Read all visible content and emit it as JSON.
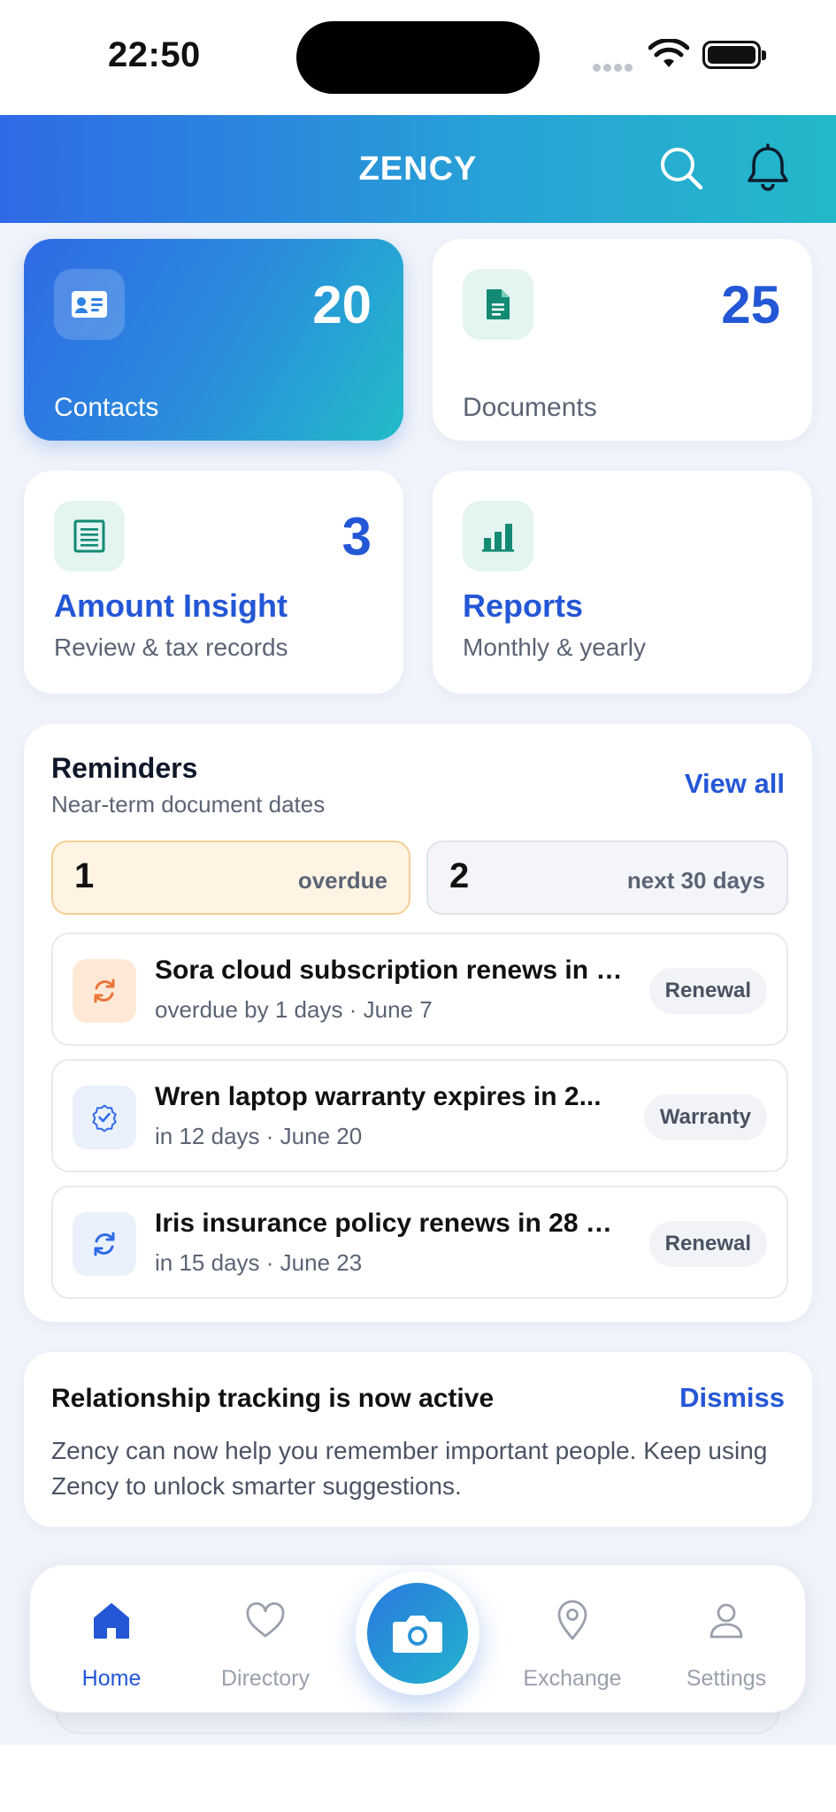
{
  "status_bar": {
    "time": "22:50"
  },
  "header": {
    "title": "ZENCY"
  },
  "stats": {
    "contacts": {
      "count": "20",
      "label": "Contacts"
    },
    "documents": {
      "count": "25",
      "label": "Documents"
    }
  },
  "features": {
    "amount_insight": {
      "count": "3",
      "title": "Amount Insight",
      "subtitle": "Review & tax records"
    },
    "reports": {
      "title": "Reports",
      "subtitle": "Monthly & yearly"
    }
  },
  "reminders": {
    "title": "Reminders",
    "subtitle": "Near-term document dates",
    "view_all": "View all",
    "overdue": {
      "count": "1",
      "label": "overdue"
    },
    "upcoming": {
      "count": "2",
      "label": "next 30 days"
    },
    "items": [
      {
        "title": "Sora cloud subscription renews in 1...",
        "due": "overdue by 1 days",
        "date": "June 7",
        "tag": "Renewal",
        "icon": "refresh-icon",
        "icon_color": "#e8743a"
      },
      {
        "title": "Wren laptop warranty expires in 2...",
        "due": "in 12 days",
        "date": "June 20",
        "tag": "Warranty",
        "icon": "shield-check-icon",
        "icon_color": "#2f6ae6"
      },
      {
        "title": "Iris insurance policy renews in 28 d...",
        "due": "in 15 days",
        "date": "June 23",
        "tag": "Renewal",
        "icon": "refresh-icon",
        "icon_color": "#2f6ae6"
      }
    ],
    "separator": "·"
  },
  "banner": {
    "title": "Relationship tracking is now active",
    "dismiss": "Dismiss",
    "body": "Zency can now help you remember important people. Keep using Zency to unlock smarter suggestions."
  },
  "tabbar": {
    "home": "Home",
    "directory": "Directory",
    "exchange": "Exchange",
    "settings": "Settings",
    "active": "home"
  },
  "colors": {
    "accent": "#2457d6",
    "gradient_start": "#2f6ae6",
    "gradient_end": "#23b8c9",
    "overdue_bg": "#fff4e4"
  }
}
